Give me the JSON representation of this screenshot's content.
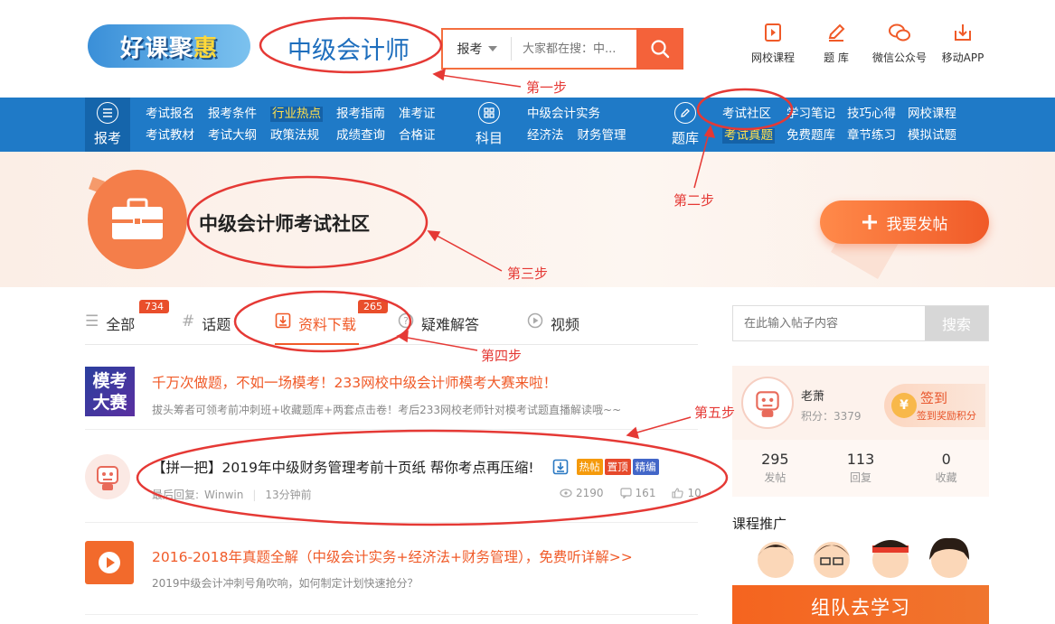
{
  "header": {
    "logo_text_a": "好课聚",
    "logo_text_b": "惠",
    "site_title": "中级会计师",
    "search_category": "报考",
    "search_placeholder": "大家都在搜：中...",
    "top_links": [
      "网校课程",
      "题 库",
      "微信公众号",
      "移动APP"
    ]
  },
  "nav": {
    "sections": [
      {
        "label": "报考",
        "icon": "menu-icon",
        "row1": [
          "考试报名",
          "报考条件",
          "行业热点",
          "报考指南",
          "准考证"
        ],
        "row2": [
          "考试教材",
          "考试大纲",
          "政策法规",
          "成绩查询",
          "合格证"
        ]
      },
      {
        "label": "科目",
        "icon": "grid-icon",
        "row1": [
          "中级会计实务"
        ],
        "row2": [
          "经济法",
          "财务管理"
        ]
      },
      {
        "label": "题库",
        "icon": "pencil-icon",
        "row1": [
          "考试社区",
          "学习笔记",
          "技巧心得",
          "网校课程"
        ],
        "row2": [
          "考试真题",
          "免费题库",
          "章节练习",
          "模拟试题"
        ]
      }
    ]
  },
  "banner": {
    "title": "中级会计师考试社区",
    "post_button": "我要发帖"
  },
  "tabs": [
    {
      "label": "全部",
      "count": "734"
    },
    {
      "label": "话题",
      "count": ""
    },
    {
      "label": "资料下载",
      "count": "265"
    },
    {
      "label": "疑难解答",
      "count": ""
    },
    {
      "label": "视频",
      "count": ""
    }
  ],
  "posts": [
    {
      "thumb_text": "模考大赛",
      "title": "千万次做题，不如一场模考！233网校中级会计师模考大赛来啦！",
      "subtitle": "拔头筹者可领考前冲刺班+收藏题库+两套点击卷！考后233网校老师针对模考试题直播解读哦~~"
    },
    {
      "title": "【拼一把】2019年中级财务管理考前十页纸 帮你考点再压缩!",
      "tags": [
        "热帖",
        "置顶",
        "精编"
      ],
      "last_reply_label": "最后回复:",
      "last_reply_user": "Winwin",
      "time": "13分钟前",
      "views": "2190",
      "comments": "161",
      "likes": "10"
    },
    {
      "title": "2016-2018年真题全解（中级会计实务+经济法+财务管理），免费听详解>>",
      "subtitle": "2019中级会计冲刺号角吹响，如何制定计划快速抢分？"
    }
  ],
  "sidebar": {
    "search_placeholder": "在此输入帖子内容",
    "search_button": "搜索",
    "user": {
      "name": "老萧",
      "points_label": "积分：3379",
      "signin_label": "签到",
      "signin_sub": "签到奖励积分"
    },
    "stats": [
      {
        "n": "295",
        "l": "发帖"
      },
      {
        "n": "113",
        "l": "回复"
      },
      {
        "n": "0",
        "l": "收藏"
      }
    ],
    "course_heading": "课程推广",
    "team_button": "组队去学习"
  },
  "annotations": [
    "第一步",
    "第二步",
    "第三步",
    "第四步",
    "第五步"
  ],
  "colors": {
    "accent": "#f05a28",
    "nav_blue": "#1f7ac7",
    "annotation_red": "#e53935",
    "title_blue": "#1e6ebd"
  }
}
